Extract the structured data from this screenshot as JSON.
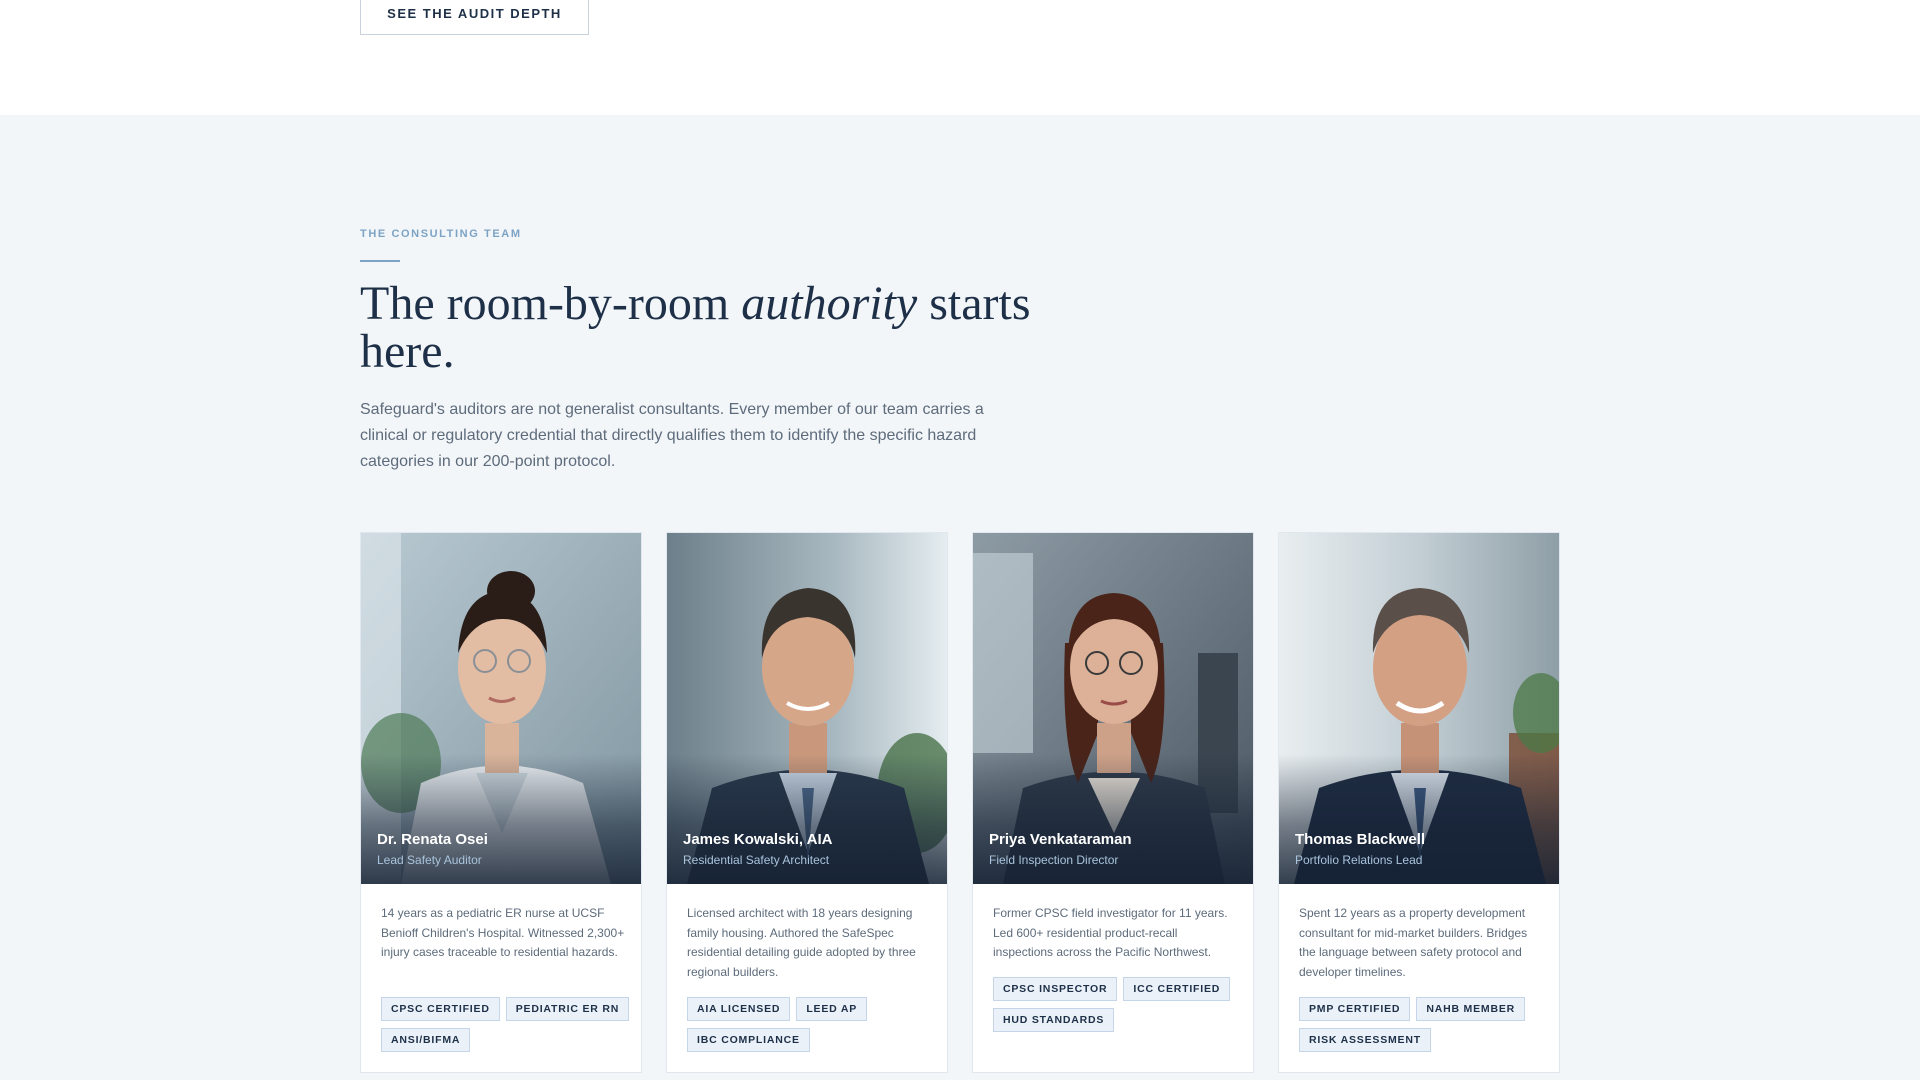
{
  "hero": {
    "audit_button_label": "SEE THE AUDIT DEPTH"
  },
  "team": {
    "eyebrow": "THE CONSULTING TEAM",
    "headline": {
      "before": "The room-by-room ",
      "emphasis": "authority",
      "after": " starts here."
    },
    "intro": "Safeguard's auditors are not generalist consultants. Every member of our team carries a clinical or regulatory credential that directly qualifies them to identify the specific hazard categories in our 200-point protocol.",
    "members": [
      {
        "name": "Dr. Renata Osei",
        "role": "Lead Safety Auditor",
        "bio": "14 years as a pediatric ER nurse at UCSF Benioff Children's Hospital. Witnessed 2,300+ injury cases traceable to residential hazards.",
        "tags": [
          "CPSC CERTIFIED",
          "PEDIATRIC ER RN",
          "ANSI/BIFMA"
        ]
      },
      {
        "name": "James Kowalski, AIA",
        "role": "Residential Safety Architect",
        "bio": "Licensed architect with 18 years designing family housing. Authored the SafeSpec residential detailing guide adopted by three regional builders.",
        "tags": [
          "AIA LICENSED",
          "LEED AP",
          "IBC COMPLIANCE"
        ]
      },
      {
        "name": "Priya Venkataraman",
        "role": "Field Inspection Director",
        "bio": "Former CPSC field investigator for 11 years. Led 600+ residential product-recall inspections across the Pacific Northwest.",
        "tags": [
          "CPSC INSPECTOR",
          "ICC CERTIFIED",
          "HUD STANDARDS"
        ]
      },
      {
        "name": "Thomas Blackwell",
        "role": "Portfolio Relations Lead",
        "bio": "Spent 12 years as a property development consultant for mid-market builders. Bridges the language between safety protocol and developer timelines.",
        "tags": [
          "PMP CERTIFIED",
          "NAHB MEMBER",
          "RISK ASSESSMENT"
        ]
      }
    ]
  },
  "colors": {
    "navy": "#1e3048",
    "accent": "#7ca3c4",
    "section_bg": "#f3f6f9",
    "tag_bg": "#eaf1f8"
  }
}
